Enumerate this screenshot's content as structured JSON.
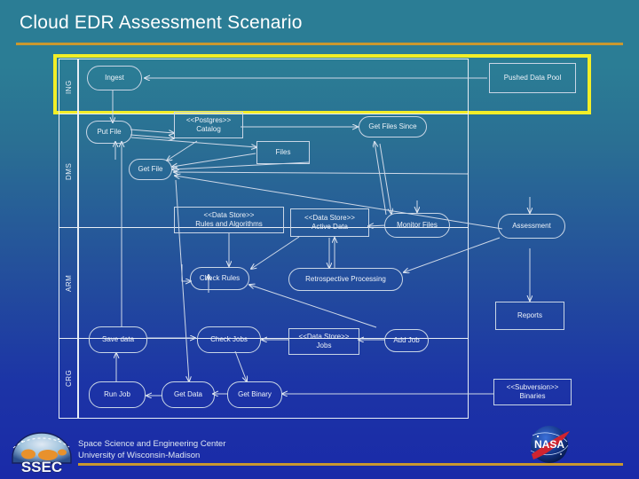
{
  "slide": {
    "title": "Cloud EDR Assessment Scenario",
    "accent_color": "#c9982f",
    "highlight_color": "#f2ee28",
    "background_top": "#2b7d95",
    "background_bottom": "#1a2aa8",
    "node_stroke": "#c9d6e6"
  },
  "diagram": {
    "lanes": [
      {
        "id": "ing",
        "label": "ING"
      },
      {
        "id": "dms",
        "label": "DMS"
      },
      {
        "id": "arm",
        "label": "ARM"
      },
      {
        "id": "crg",
        "label": "CRG"
      }
    ],
    "nodes": [
      {
        "id": "ingest",
        "label": "Ingest",
        "shape": "round",
        "lane": "ing"
      },
      {
        "id": "pushed-pool",
        "label": "Pushed Data Pool",
        "shape": "rect",
        "lane": "ing"
      },
      {
        "id": "put-file",
        "label": "Put File",
        "shape": "round",
        "lane": "dms"
      },
      {
        "id": "catalog",
        "label": "Catalog",
        "stereotype": "<<Postgres>>",
        "shape": "rect",
        "lane": "dms"
      },
      {
        "id": "get-files-since",
        "label": "Get Files Since",
        "shape": "round",
        "lane": "dms"
      },
      {
        "id": "files",
        "label": "Files",
        "shape": "rect",
        "lane": "dms"
      },
      {
        "id": "get-file",
        "label": "Get File",
        "shape": "round",
        "lane": "dms"
      },
      {
        "id": "rules-algos",
        "label": "Rules and Algorithms",
        "stereotype": "<<Data Store>>",
        "shape": "rect",
        "lane": "arm"
      },
      {
        "id": "active-data",
        "label": "Active Data",
        "stereotype": "<<Data Store>>",
        "shape": "rect",
        "lane": "arm"
      },
      {
        "id": "monitor-files",
        "label": "Monitor Files",
        "shape": "round",
        "lane": "arm"
      },
      {
        "id": "assessment",
        "label": "Assessment",
        "shape": "round",
        "lane": "arm"
      },
      {
        "id": "check-rules",
        "label": "Check Rules",
        "shape": "round",
        "lane": "arm"
      },
      {
        "id": "retro-proc",
        "label": "Retrospective Processing",
        "shape": "round",
        "lane": "arm"
      },
      {
        "id": "reports",
        "label": "Reports",
        "shape": "rect",
        "lane": "arm"
      },
      {
        "id": "save-data",
        "label": "Save data",
        "shape": "round",
        "lane": "crg"
      },
      {
        "id": "check-jobs",
        "label": "Check Jobs",
        "shape": "round",
        "lane": "crg"
      },
      {
        "id": "jobs-store",
        "label": "Jobs",
        "stereotype": "<<Data Store>>",
        "shape": "rect",
        "lane": "crg"
      },
      {
        "id": "add-job",
        "label": "Add Job",
        "shape": "round",
        "lane": "crg"
      },
      {
        "id": "run-job",
        "label": "Run Job",
        "shape": "round",
        "lane": "crg"
      },
      {
        "id": "get-data",
        "label": "Get Data",
        "shape": "round",
        "lane": "crg"
      },
      {
        "id": "get-binary",
        "label": "Get Binary",
        "shape": "round",
        "lane": "crg"
      },
      {
        "id": "binaries",
        "label": "Binaries",
        "stereotype": "<<Subversion>>",
        "shape": "rect",
        "lane": "crg"
      }
    ]
  },
  "footer": {
    "line1": "Space Science and Engineering Center",
    "line2": "University of Wisconsin-Madison",
    "ssec_logo_text": "SSEC",
    "nasa_logo_text": "NASA"
  }
}
